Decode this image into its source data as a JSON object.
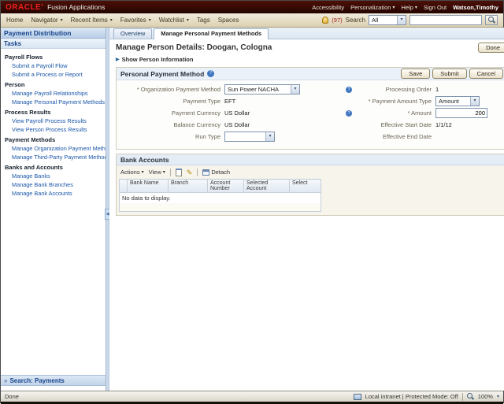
{
  "branding": {
    "oracle": "ORACLE'",
    "suite": "Fusion Applications"
  },
  "topbar": {
    "links": [
      "Accessibility",
      "Personalization",
      "Help",
      "Sign Out"
    ],
    "user": "Watson,Timothy"
  },
  "menubar": {
    "items": [
      "Home",
      "Navigator",
      "Recent Items",
      "Favorites",
      "Watchlist",
      "Tags",
      "Spaces"
    ],
    "notification_count": "(97)",
    "search_label": "Search",
    "search_scope": "All"
  },
  "sidebar": {
    "title": "Payment Distribution",
    "tasks_title": "Tasks",
    "groups": [
      {
        "label": "Payroll Flows",
        "items": [
          "Submit a Payroll Flow",
          "Submit a Process or Report"
        ]
      },
      {
        "label": "Person",
        "items": [
          "Manage Payroll Relationships",
          "Manage Personal Payment Methods"
        ]
      },
      {
        "label": "Process Results",
        "items": [
          "View Payroll Process Results",
          "View Person Process Results"
        ]
      },
      {
        "label": "Payment Methods",
        "items": [
          "Manage Organization Payment Methods",
          "Manage Third-Party Payment Methods"
        ]
      },
      {
        "label": "Banks and Accounts",
        "items": [
          "Manage Banks",
          "Manage Bank Branches",
          "Manage Bank Accounts"
        ]
      }
    ],
    "search_bar": "Search: Payments"
  },
  "main": {
    "tabs": [
      "Overview",
      "Manage Personal Payment Methods"
    ],
    "page_title": "Manage Person Details: Doogan, Cologna",
    "done_label": "Done",
    "show_person_info": "Show Person Information",
    "ppm": {
      "title": "Personal Payment Method",
      "save_label": "Save",
      "submit_label": "Submit",
      "cancel_label": "Cancel",
      "fields_left": [
        {
          "label": "* Organization Payment Method",
          "value": "Sun Power NACHA"
        },
        {
          "label": "Payment Type",
          "value": "EFT"
        },
        {
          "label": "Payment Currency",
          "value": "US Dollar"
        },
        {
          "label": "Balance Currency",
          "value": "US Dollar"
        },
        {
          "label": "Run Type",
          "value": ""
        }
      ],
      "fields_right": [
        {
          "label": "Processing Order",
          "value": "1"
        },
        {
          "label": "* Payment Amount Type",
          "value": "Amount"
        },
        {
          "label": "* Amount",
          "value": "200"
        },
        {
          "label": "Effective Start Date",
          "value": "1/1/12"
        },
        {
          "label": "Effective End Date",
          "value": ""
        }
      ]
    },
    "bank_accounts": {
      "title": "Bank Accounts",
      "actions_label": "Actions",
      "view_label": "View",
      "detach_label": "Detach",
      "columns": [
        "Bank Name",
        "Branch",
        "Account Number",
        "Selected Account",
        "Select"
      ],
      "empty_message": "No data to display."
    }
  },
  "statusbar": {
    "status": "Done",
    "zone": "Local intranet | Protected Mode: Off",
    "zoom": "100%"
  },
  "icons": {
    "caret": "▾",
    "up_arrow": "▲",
    "down_arrow": "▼",
    "collapse_left": "◀",
    "expand_right": "▶",
    "chevrons": "»",
    "help": "?",
    "pencil": "✎"
  }
}
